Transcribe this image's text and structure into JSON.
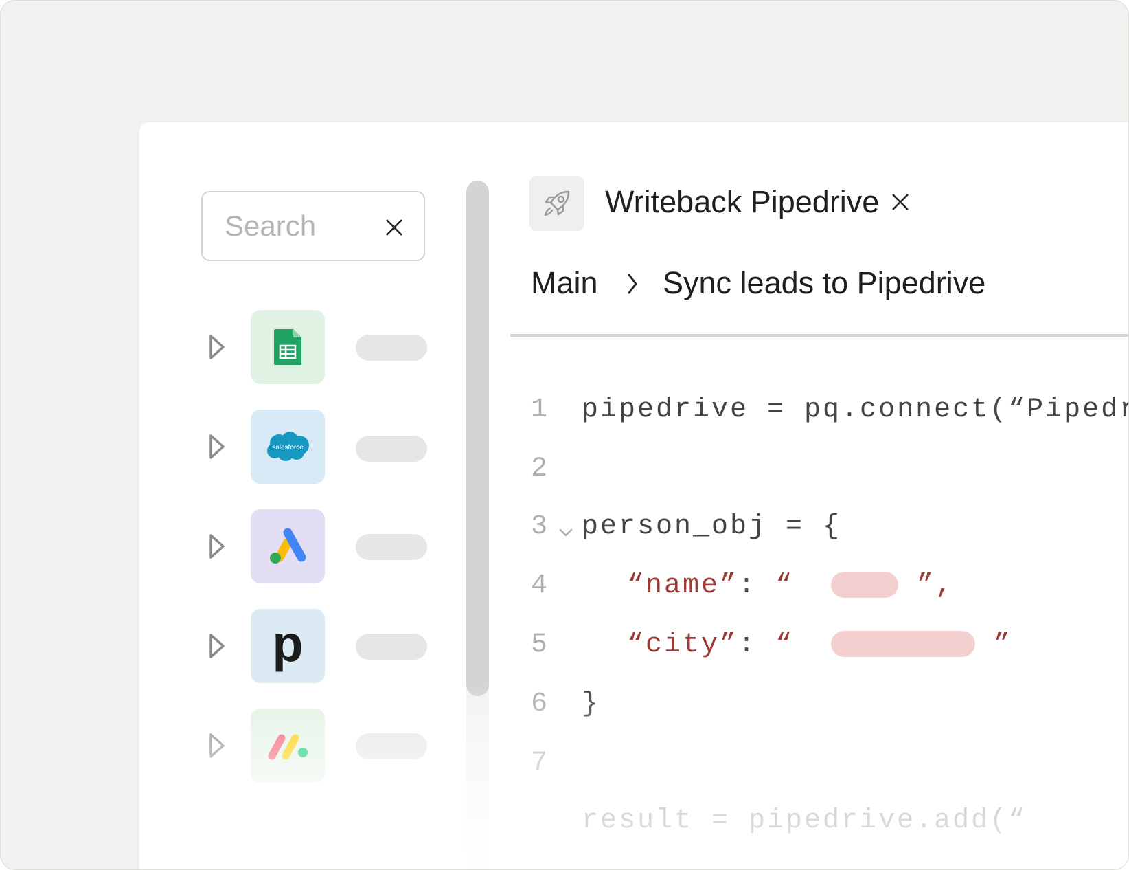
{
  "search": {
    "placeholder": "Search"
  },
  "sidebar": {
    "items": [
      {
        "icon": "google-sheets-icon",
        "tile_color": "#dff2e3"
      },
      {
        "icon": "salesforce-icon",
        "tile_color": "#d8eaf5",
        "logo_text": "salesforce"
      },
      {
        "icon": "google-ads-icon",
        "tile_color": "#e3def3"
      },
      {
        "icon": "pipedrive-icon",
        "tile_color": "#dceaf4",
        "logo_text": "p"
      },
      {
        "icon": "monday-icon",
        "tile_color": "#e3f3e5"
      }
    ]
  },
  "tab": {
    "icon": "rocket-icon",
    "title": "Writeback Pipedrive"
  },
  "breadcrumb": {
    "root": "Main",
    "current": "Sync leads to Pipedrive"
  },
  "editor": {
    "lines": [
      {
        "num": "1",
        "code": "pipedrive = pq.connect(“Pipedr"
      },
      {
        "num": "2",
        "code": ""
      },
      {
        "num": "3",
        "code": "person_obj = {"
      },
      {
        "num": "4",
        "key": "“name”",
        "colon": ":",
        "open_quote": "“",
        "close_quote": "”,",
        "redaction": "short"
      },
      {
        "num": "5",
        "key": "“city”",
        "colon": ":",
        "open_quote": "“",
        "close_quote": "”",
        "redaction": "long"
      },
      {
        "num": "6",
        "code": "}"
      },
      {
        "num": "7",
        "code": ""
      },
      {
        "num": "",
        "code": "result = pipedrive.add(“"
      }
    ]
  },
  "colors": {
    "string": "#9b3a34",
    "redaction": "#f4cfcf",
    "pill": "#e6e6e6"
  }
}
